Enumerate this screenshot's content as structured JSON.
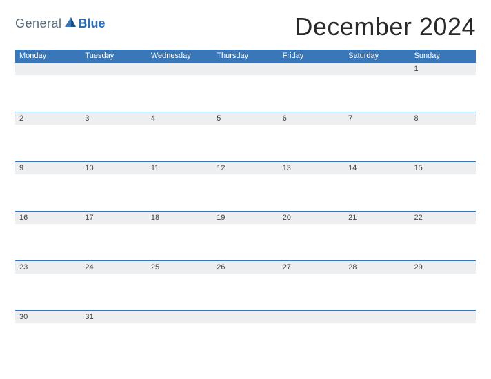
{
  "logo": {
    "part1": "General",
    "part2": "Blue"
  },
  "title": "December 2024",
  "colors": {
    "accent": "#3a77b8",
    "header_bg": "#3a77b8",
    "row_bg": "#eceef0"
  },
  "days": [
    "Monday",
    "Tuesday",
    "Wednesday",
    "Thursday",
    "Friday",
    "Saturday",
    "Sunday"
  ],
  "weeks": [
    [
      "",
      "",
      "",
      "",
      "",
      "",
      "1"
    ],
    [
      "2",
      "3",
      "4",
      "5",
      "6",
      "7",
      "8"
    ],
    [
      "9",
      "10",
      "11",
      "12",
      "13",
      "14",
      "15"
    ],
    [
      "16",
      "17",
      "18",
      "19",
      "20",
      "21",
      "22"
    ],
    [
      "23",
      "24",
      "25",
      "26",
      "27",
      "28",
      "29"
    ],
    [
      "30",
      "31",
      "",
      "",
      "",
      "",
      ""
    ]
  ]
}
